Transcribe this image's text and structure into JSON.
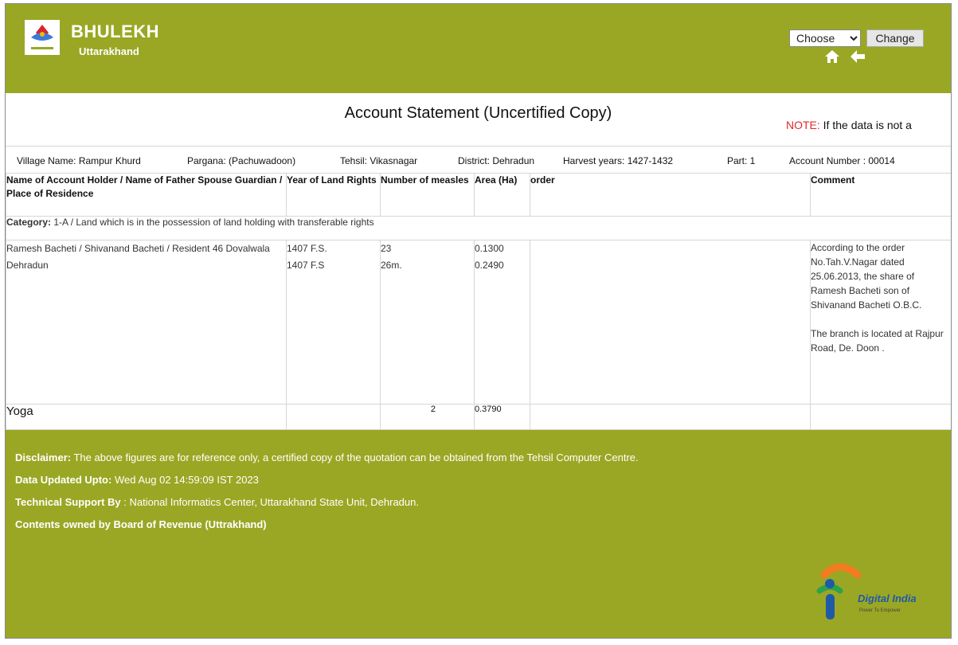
{
  "header": {
    "brand_title": "BHULEKH",
    "brand_subtitle": "Uttarakhand",
    "language_select_value": "Choose",
    "change_button_label": "Change"
  },
  "title_bar": {
    "page_title": "Account Statement (Uncertified Copy)",
    "note_label": "NOTE:",
    "note_text": "If the data is not a"
  },
  "info": {
    "village": "Village Name: Rampur Khurd",
    "pargana": "Pargana: (Pachuwadoon)",
    "tehsil": "Tehsil: Vikasnagar",
    "district": "District: Dehradun",
    "harvest_years": "Harvest years: 1427-1432",
    "part": "Part: 1",
    "account_number": "Account Number : 00014"
  },
  "table": {
    "headers": [
      "Name of Account Holder / Name of Father Spouse Guardian / Place of Residence",
      "Year of Land Rights",
      "Number of measles",
      "Area (Ha)",
      "order",
      "Comment"
    ],
    "category_label": "Category:",
    "category_text": "1-A / Land which is in the possession of land holding with transferable rights",
    "row": {
      "holder": "Ramesh Bacheti / Shivanand Bacheti / Resident 46 Dovalwala Dehradun",
      "years": [
        "1407 F.S.",
        "1407 F.S"
      ],
      "measles": [
        "23",
        "26m."
      ],
      "areas": [
        "0.1300",
        "0.2490"
      ],
      "order": "",
      "comment_1": "According to the order No.Tah.V.Nagar dated 25.06.2013, the share of Ramesh Bacheti son of Shivanand Bacheti O.B.C.",
      "comment_2": "The branch is located at Rajpur Road, De. Doon ."
    },
    "total": {
      "label": "Yoga",
      "measles": "2",
      "area": "0.3790"
    }
  },
  "footer": {
    "disclaimer_label": "Disclaimer:",
    "disclaimer_text": "The above figures are for reference only, a certified copy of the quotation can be obtained from the Tehsil Computer Centre.",
    "updated_label": "Data Updated Upto:",
    "updated_text": "Wed Aug 02 14:59:09 IST 2023",
    "support_label": "Technical Support By",
    "support_text": ": National Informatics Center, Uttarakhand State Unit, Dehradun.",
    "owner_text": "Contents owned by Board of Revenue (Uttrakhand)",
    "digital_india_text": "Digital India",
    "digital_india_tagline": "Power To Empower"
  },
  "colors": {
    "header_bg": "#9aa724",
    "note_red": "#e02b2b",
    "di_orange": "#f47b20",
    "di_green": "#2ca24b",
    "di_blue": "#1f5aa6"
  },
  "icons": [
    "uttarakhand-emblem-icon",
    "home-icon",
    "back-arrow-icon",
    "digital-india-logo"
  ]
}
